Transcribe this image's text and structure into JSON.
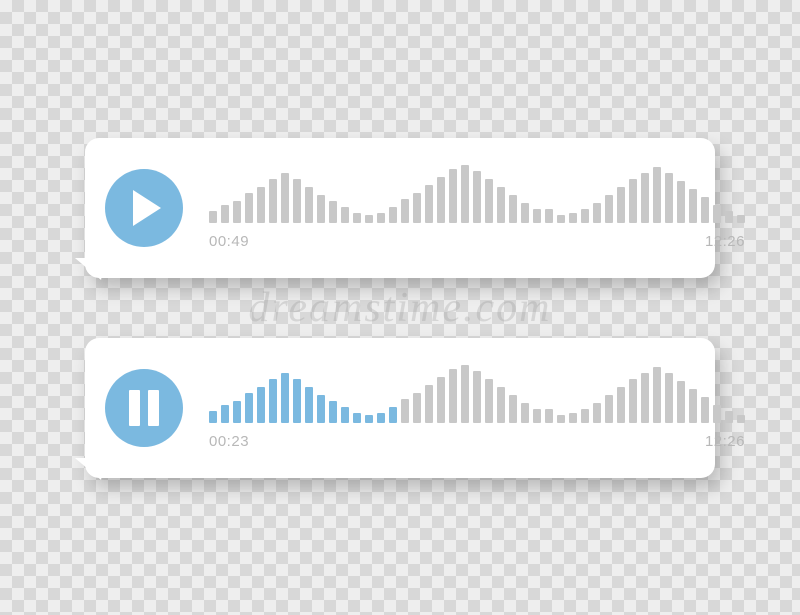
{
  "watermark": "dreamstime.com",
  "accent_color": "#7bb9e0",
  "bar_inactive_color": "#c8c8c8",
  "messages": [
    {
      "state": "paused",
      "elapsed": "00:49",
      "total": "12:26",
      "bars": [
        12,
        18,
        22,
        30,
        36,
        44,
        50,
        44,
        36,
        28,
        22,
        16,
        10,
        8,
        10,
        16,
        24,
        30,
        38,
        46,
        54,
        58,
        52,
        44,
        36,
        28,
        20,
        14,
        14,
        8,
        10,
        14,
        20,
        28,
        36,
        44,
        50,
        56,
        50,
        42,
        34,
        26,
        18,
        12,
        8
      ],
      "played_count": 0
    },
    {
      "state": "playing",
      "elapsed": "00:23",
      "total": "12:26",
      "bars": [
        12,
        18,
        22,
        30,
        36,
        44,
        50,
        44,
        36,
        28,
        22,
        16,
        10,
        8,
        10,
        16,
        24,
        30,
        38,
        46,
        54,
        58,
        52,
        44,
        36,
        28,
        20,
        14,
        14,
        8,
        10,
        14,
        20,
        28,
        36,
        44,
        50,
        56,
        50,
        42,
        34,
        26,
        18,
        12,
        8
      ],
      "played_count": 16
    }
  ]
}
